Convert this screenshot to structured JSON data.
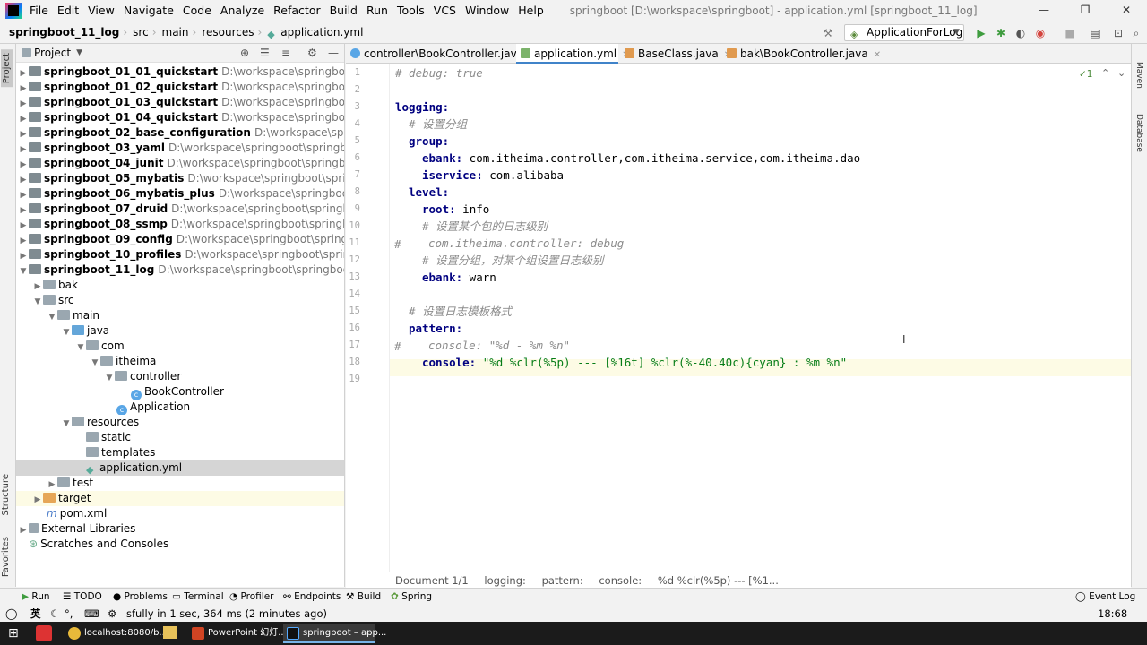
{
  "menubar": {
    "items": [
      "File",
      "Edit",
      "View",
      "Navigate",
      "Code",
      "Analyze",
      "Refactor",
      "Build",
      "Run",
      "Tools",
      "VCS",
      "Window",
      "Help"
    ],
    "title": "springboot [D:\\workspace\\springboot] - application.yml [springboot_11_log]"
  },
  "navbar": {
    "crumbs": [
      "springboot_11_log",
      "src",
      "main",
      "resources",
      "application.yml"
    ],
    "run_config": "ApplicationForLog"
  },
  "project": {
    "header": "Project",
    "tree": [
      {
        "name": "springboot_01_01_quickstart",
        "path": "D:\\workspace\\springboot\\springt"
      },
      {
        "name": "springboot_01_02_quickstart",
        "path": "D:\\workspace\\springboot\\springt"
      },
      {
        "name": "springboot_01_03_quickstart",
        "path": "D:\\workspace\\springboot\\springt"
      },
      {
        "name": "springboot_01_04_quickstart",
        "path": "D:\\workspace\\springboot\\springt"
      },
      {
        "name": "springboot_02_base_configuration",
        "path": "D:\\workspace\\springboot\\s"
      },
      {
        "name": "springboot_03_yaml",
        "path": "D:\\workspace\\springboot\\springboot_03_y"
      },
      {
        "name": "springboot_04_junit",
        "path": "D:\\workspace\\springboot\\springboot_04_ju"
      },
      {
        "name": "springboot_05_mybatis",
        "path": "D:\\workspace\\springboot\\springboot_0"
      },
      {
        "name": "springboot_06_mybatis_plus",
        "path": "D:\\workspace\\springboot\\springb"
      },
      {
        "name": "springboot_07_druid",
        "path": "D:\\workspace\\springboot\\springboot_07_"
      },
      {
        "name": "springboot_08_ssmp",
        "path": "D:\\workspace\\springboot\\springboot_08_s"
      },
      {
        "name": "springboot_09_config",
        "path": "D:\\workspace\\springboot\\springboot_09"
      },
      {
        "name": "springboot_10_profiles",
        "path": "D:\\workspace\\springboot\\springboot_1"
      },
      {
        "name": "springboot_11_log",
        "path": "D:\\workspace\\springboot\\springboot_11_loc"
      }
    ],
    "sub": [
      "bak",
      "src",
      "main",
      "java",
      "com",
      "itheima",
      "controller",
      "BookController",
      "Application",
      "resources",
      "static",
      "templates",
      "application.yml",
      "test",
      "target",
      "pom.xml",
      "External Libraries",
      "Scratches and Consoles"
    ]
  },
  "tabs": [
    "controller\\BookController.java",
    "application.yml",
    "BaseClass.java",
    "bak\\BookController.java"
  ],
  "editor": {
    "line_numbers": [
      "1",
      "2",
      "3",
      "4",
      "5",
      "6",
      "7",
      "8",
      "9",
      "10",
      "11",
      "12",
      "13",
      "14",
      "15",
      "16",
      "17",
      "18",
      "19"
    ],
    "l1": "# debug: true",
    "l3": "logging:",
    "l4": "# 设置分组",
    "l5": "group:",
    "l6_key": "ebank:",
    "l6_val": " com.itheima.controller,com.itheima.service,com.itheima.dao",
    "l7_key": "iservice:",
    "l7_val": " com.alibaba",
    "l8": "level:",
    "l9_key": "root:",
    "l9_val": " info",
    "l10": "# 设置某个包的日志级别",
    "l11_hash": "#",
    "l11": "com.itheima.controller: debug",
    "l12": "# 设置分组，对某个组设置日志级别",
    "l13_key": "ebank:",
    "l13_val": " warn",
    "l15": "# 设置日志模板格式",
    "l16": "pattern:",
    "l17_hash": "#",
    "l17": "console: \"%d - %m %n\"",
    "l18_key": "console:",
    "l18_val": " \"%d %clr(%5p) --- [%16t] %clr(%-40.40c){cyan} : %m %n\"",
    "inspection": "✓1"
  },
  "breadcrumbs": {
    "doc": "Document 1/1",
    "path": [
      "logging:",
      "pattern:",
      "console:",
      "%d %clr(%5p) --- [%1..."
    ]
  },
  "toolwindows": [
    "Run",
    "TODO",
    "Problems",
    "Terminal",
    "Profiler",
    "Endpoints",
    "Build",
    "Spring",
    "Event Log"
  ],
  "statusbar": {
    "ime": "英",
    "message": "sfully in 1 sec, 364 ms (2 minutes ago)",
    "position": "18:68"
  },
  "taskbar": {
    "items": [
      "localhost:8080/b...",
      "PowerPoint 幻灯...",
      "springboot – app..."
    ]
  },
  "side": {
    "project": "Project",
    "structure": "Structure",
    "favorites": "Favorites",
    "maven": "Maven",
    "database": "Database"
  }
}
